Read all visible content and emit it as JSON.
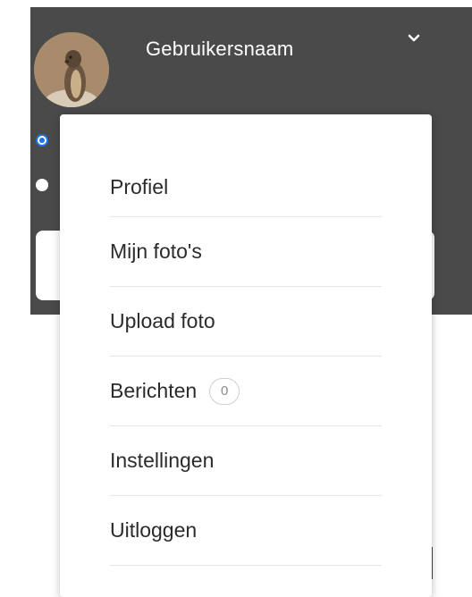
{
  "header": {
    "username": "Gebruikersnaam",
    "avatar_icon": "user-avatar",
    "toggle_icon": "chevron-down-icon"
  },
  "radio_options": [
    {
      "checked": true
    },
    {
      "checked": false
    }
  ],
  "menu": {
    "items": [
      {
        "label": "Profiel"
      },
      {
        "label": "Mijn foto's"
      },
      {
        "label": "Upload foto"
      },
      {
        "label": "Berichten",
        "badge": "0"
      },
      {
        "label": "Instellingen"
      },
      {
        "label": "Uitloggen"
      }
    ]
  },
  "colors": {
    "header_bg": "#4a4a4a",
    "accent": "#1a73e8",
    "menu_text": "#2b2b2b"
  }
}
